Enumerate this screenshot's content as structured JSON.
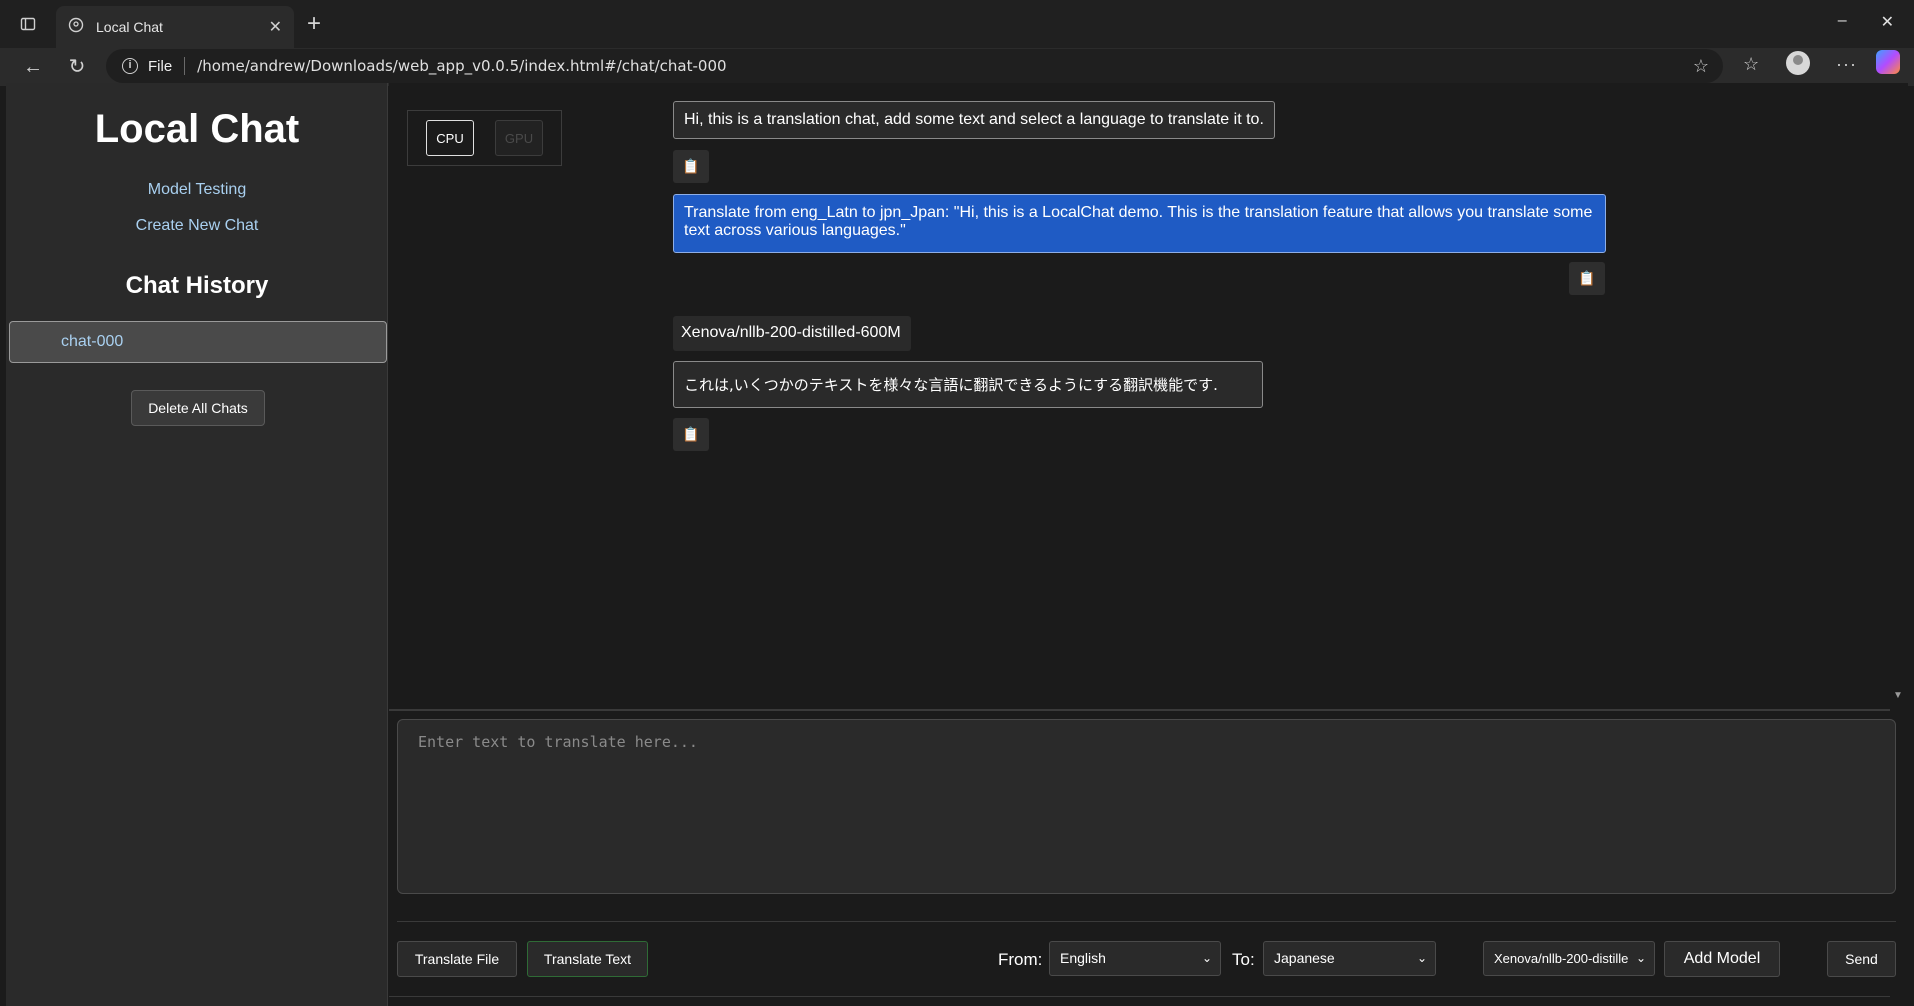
{
  "browser": {
    "tab_title": "Local Chat",
    "address_scheme": "File",
    "address_url": "/home/andrew/Downloads/web_app_v0.0.5/index.html#/chat/chat-000"
  },
  "sidebar": {
    "title": "Local Chat",
    "links": [
      "Model Testing",
      "Create New Chat"
    ],
    "history_title": "Chat History",
    "chats": [
      "chat-000"
    ],
    "delete_label": "Delete All Chats"
  },
  "device": {
    "cpu_label": "CPU",
    "gpu_label": "GPU"
  },
  "messages": {
    "system": "Hi, this is a translation chat, add some text and select a language to translate it to.",
    "user": "Translate from eng_Latn to jpn_Jpan: \"Hi, this is a LocalChat demo. This is the translation feature that allows you translate some text across various languages.\"",
    "model_name": "Xenova/nllb-200-distilled-600M",
    "response": "これは,いくつかのテキストを様々な言語に翻訳できるようにする翻訳機能です."
  },
  "input": {
    "placeholder": "Enter text to translate here..."
  },
  "controls": {
    "translate_file": "Translate File",
    "translate_text": "Translate Text",
    "from_label": "From:",
    "from_value": "English",
    "to_label": "To:",
    "to_value": "Japanese",
    "model_value": "Xenova/nllb-200-distille",
    "add_model": "Add Model",
    "send": "Send"
  },
  "icons": {
    "copy": "clipboard-icon"
  }
}
